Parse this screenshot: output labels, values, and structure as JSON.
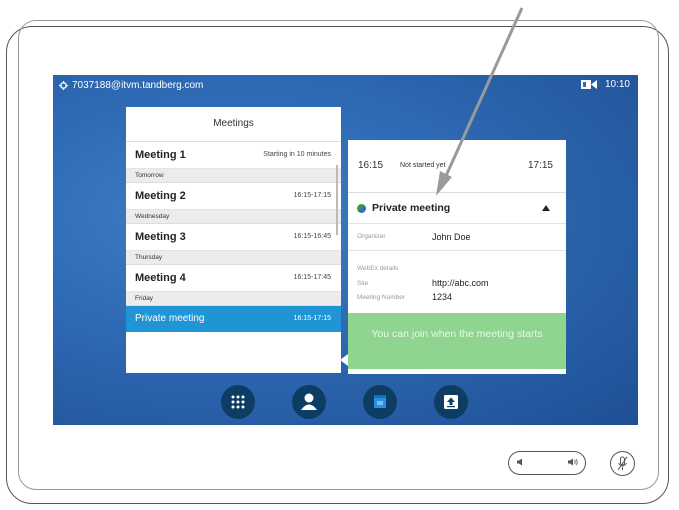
{
  "status_bar": {
    "user": "7037188@itvm.tandberg.com",
    "time": "10:10"
  },
  "meetings_panel": {
    "title": "Meetings",
    "items": [
      {
        "type": "meeting",
        "title": "Meeting 1",
        "time": "Starting in 10 minutes"
      },
      {
        "type": "section",
        "label": "Tomorrow"
      },
      {
        "type": "meeting",
        "title": "Meeting 2",
        "time": "16:15-17:15"
      },
      {
        "type": "section",
        "label": "Wednesday"
      },
      {
        "type": "meeting",
        "title": "Meeting 3",
        "time": "16:15-16:45"
      },
      {
        "type": "section",
        "label": "Thursday"
      },
      {
        "type": "meeting",
        "title": "Meeting 4",
        "time": "16:15-17:45"
      },
      {
        "type": "section",
        "label": "Friday"
      },
      {
        "type": "meeting",
        "title": "Private meeting",
        "time": "16:15-17:15",
        "selected": true
      }
    ]
  },
  "details_panel": {
    "start_time": "16:15",
    "status": "Not started yet",
    "end_time": "17:15",
    "meeting_title": "Private meeting",
    "organizer_label": "Organizer",
    "organizer": "John Doe",
    "webex_label": "WebEx details",
    "site_label": "Site",
    "site": "http://abc.com",
    "meeting_number_label": "Meeting Number",
    "meeting_number": "1234",
    "join_message": "You can join when the meeting starts"
  },
  "colors": {
    "screen_background": "#2f6bb5",
    "selected_row": "#1f95d6",
    "join_banner": "#8fd48f",
    "app_button": "#0e3d63"
  },
  "app_buttons": [
    "keypad-icon",
    "contacts-icon",
    "calendar-icon",
    "share-icon"
  ]
}
